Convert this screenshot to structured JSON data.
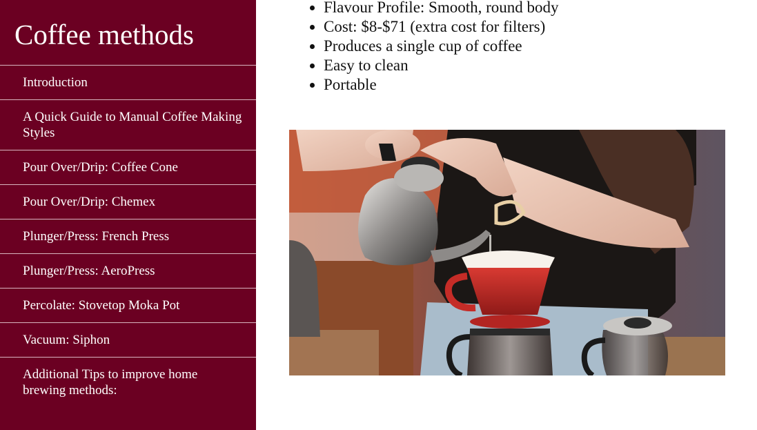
{
  "sidebar": {
    "title": "Coffee methods",
    "items": [
      {
        "label": "Introduction"
      },
      {
        "label": "A Quick Guide to Manual Coffee Making Styles"
      },
      {
        "label": "Pour Over/Drip: Coffee Cone"
      },
      {
        "label": "Pour Over/Drip: Chemex"
      },
      {
        "label": "Plunger/Press: French Press"
      },
      {
        "label": "Plunger/Press: AeroPress"
      },
      {
        "label": "Percolate: Stovetop Moka Pot"
      },
      {
        "label": "Vacuum: Siphon"
      },
      {
        "label": "Additional Tips to improve home brewing methods:"
      }
    ],
    "bg_color": "#6b0022"
  },
  "main": {
    "bullets": [
      "Flavour Profile: Smooth, round body",
      "Cost: $8-$71 (extra cost for filters)",
      "Produces a single cup of coffee",
      "Easy to clean",
      "Portable"
    ]
  }
}
